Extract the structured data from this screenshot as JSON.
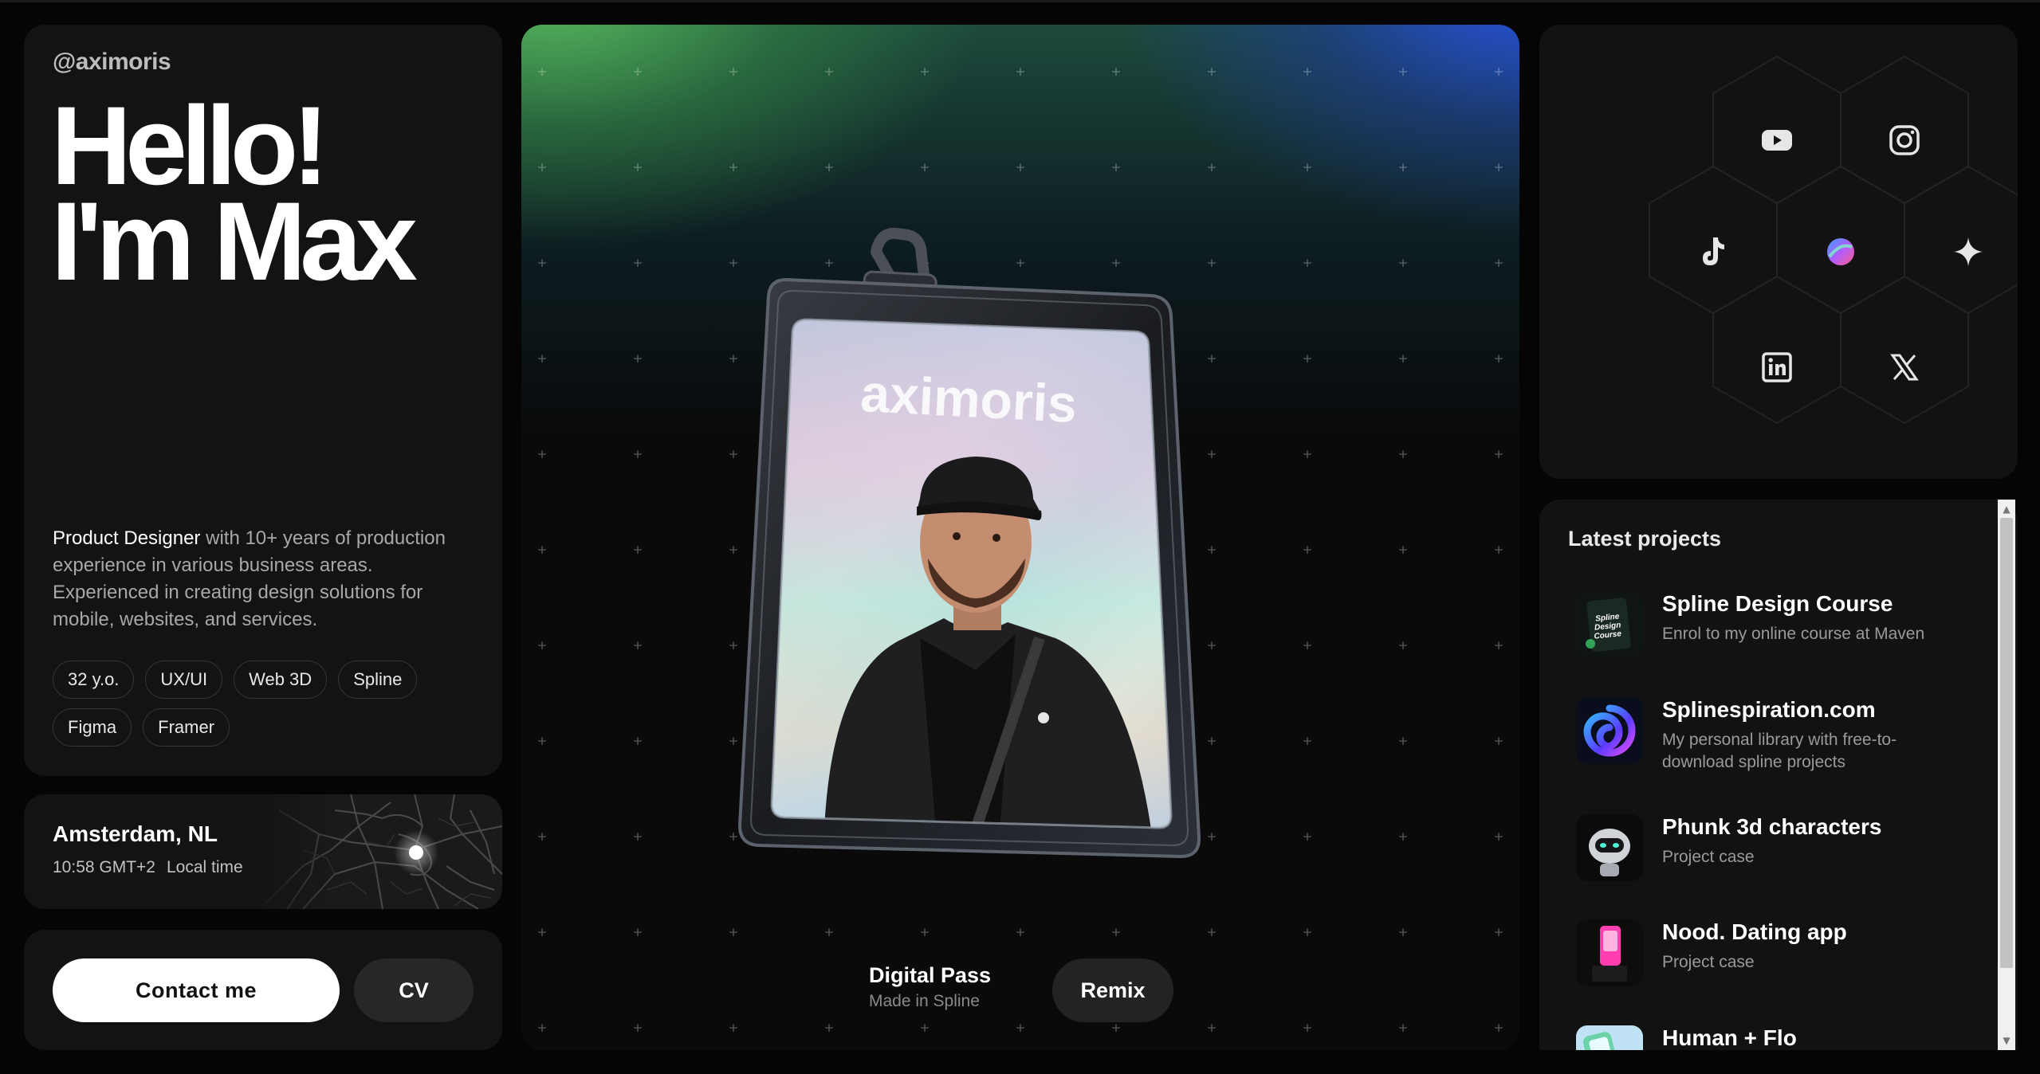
{
  "intro": {
    "handle": "@aximoris",
    "greeting_line1": "Hello!",
    "greeting_line2": "I'm Max",
    "bio_strong": "Product Designer",
    "bio_rest": " with 10+ years of production experience in various business areas. Experienced in creating design solutions for mobile, websites, and services.",
    "tags": [
      "32 y.o.",
      "UX/UI",
      "Web 3D",
      "Spline",
      "Figma",
      "Framer"
    ]
  },
  "location": {
    "city": "Amsterdam, NL",
    "time": "10:58 GMT+2",
    "time_label": "Local time"
  },
  "contact": {
    "contact_label": "Contact me",
    "cv_label": "CV"
  },
  "hero": {
    "badge_brand": "aximoris",
    "title": "Digital Pass",
    "subtitle": "Made in Spline",
    "remix_label": "Remix"
  },
  "social": {
    "icons": [
      "youtube-icon",
      "instagram-icon",
      "tiktok-icon",
      "spline-logo-icon",
      "sparkle-icon",
      "linkedin-icon",
      "x-icon"
    ]
  },
  "projects": {
    "heading": "Latest projects",
    "items": [
      {
        "title": "Spline Design Course",
        "subtitle": "Enrol to my online course at Maven",
        "thumb_text": "Spline Design Course"
      },
      {
        "title": "Splinespiration.com",
        "subtitle": "My personal library with free-to-download spline projects"
      },
      {
        "title": "Phunk 3d characters",
        "subtitle": "Project case"
      },
      {
        "title": "Nood. Dating app",
        "subtitle": "Project case"
      },
      {
        "title": "Human + Flo",
        "subtitle": ""
      }
    ]
  },
  "colors": {
    "background": "#050505",
    "card": "#131313",
    "accent_green": "#4caf5a",
    "accent_blue": "#2a4fd8",
    "text_muted": "#a8a8a8"
  }
}
